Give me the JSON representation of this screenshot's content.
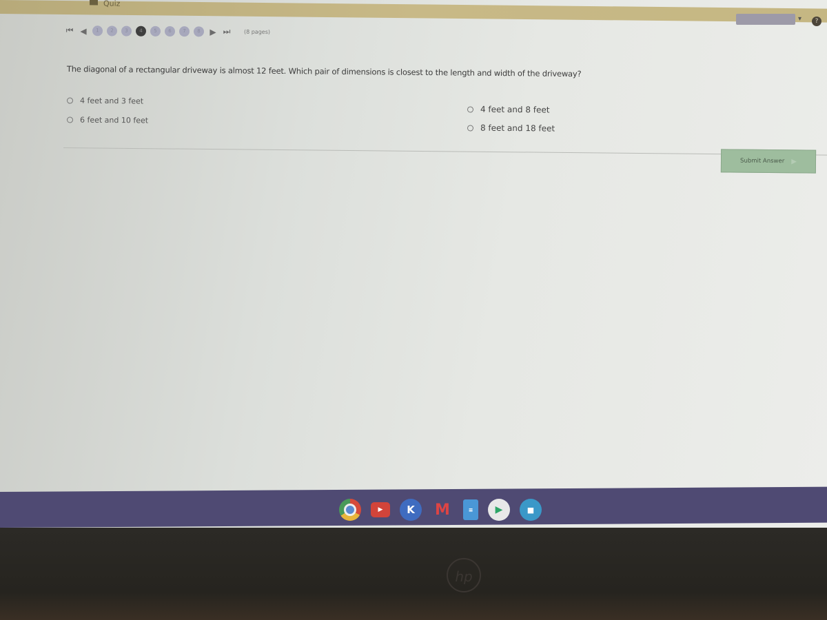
{
  "browser": {
    "tab_label": "Quiz",
    "help_icon": "help-icon"
  },
  "pager": {
    "first_icon": "⏮",
    "prev_icon": "◀",
    "pages": [
      "1",
      "2",
      "3",
      "4",
      "5",
      "6",
      "7",
      "8"
    ],
    "current_page": "4",
    "next_icon": "▶",
    "last_icon": "⏭",
    "count_text": "(8 pages)"
  },
  "question": {
    "text": "The diagonal of a rectangular driveway is almost 12 feet. Which pair of dimensions is closest to the length and width of the driveway?",
    "choices": [
      {
        "label": "4 feet and 3 feet",
        "selected": false
      },
      {
        "label": "6 feet and 10 feet",
        "selected": false
      },
      {
        "label": "4 feet and 8 feet",
        "selected": false
      },
      {
        "label": "8 feet and 18 feet",
        "selected": false
      }
    ]
  },
  "actions": {
    "submit_label": "Submit Answer",
    "submit_arrow": "▶"
  },
  "shelf": {
    "apps": [
      {
        "name": "Chrome",
        "icon": "chrome-icon"
      },
      {
        "name": "YouTube",
        "icon": "youtube-icon",
        "glyph": "▶"
      },
      {
        "name": "Kami",
        "icon": "kami-icon",
        "glyph": "K"
      },
      {
        "name": "Gmail",
        "icon": "gmail-icon",
        "glyph": "M"
      },
      {
        "name": "Docs",
        "icon": "docs-icon",
        "glyph": "≡"
      },
      {
        "name": "Play Store",
        "icon": "play-store-icon",
        "glyph": "▶"
      },
      {
        "name": "Meet",
        "icon": "meet-icon",
        "glyph": "■"
      }
    ]
  },
  "device": {
    "logo_text": "hp"
  },
  "colors": {
    "submit_bg": "#9ebd9e",
    "shelf_bg": "#4f4a73",
    "current_page_dot": "#3f3f3f"
  }
}
